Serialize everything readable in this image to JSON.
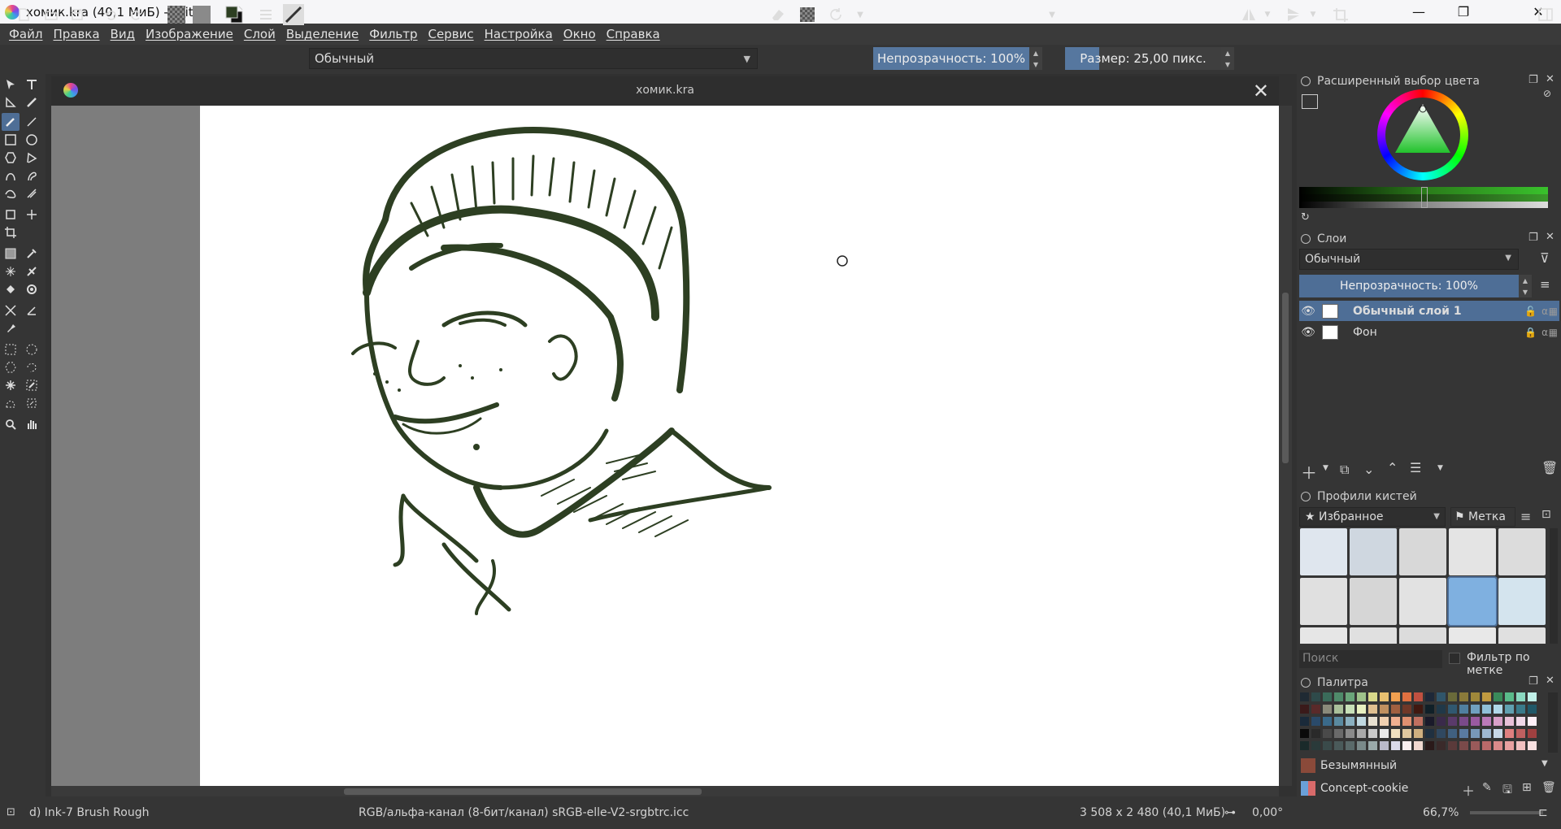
{
  "window": {
    "title": "хомик.kra (40,1 МиБ)  - Krita",
    "minimize": "—",
    "restore": "❐",
    "close": "✕"
  },
  "menu": [
    "Файл",
    "Правка",
    "Вид",
    "Изображение",
    "Слой",
    "Выделение",
    "Фильтр",
    "Сервис",
    "Настройка",
    "Окно",
    "Справка"
  ],
  "toolbar": {
    "preset_name": "Обычный",
    "opacity_label": "Непрозрачность: 100%",
    "opacity_value": 1.0,
    "size_label": "Размер: 25,00 пикс.",
    "size_value": 25.0
  },
  "document": {
    "tab_title": "хомик.kra",
    "close": "✕"
  },
  "dockers": {
    "color_selector": {
      "title": "Расширенный выбор цвета",
      "current_color": "#2d3f22"
    },
    "layers": {
      "title": "Слои",
      "blend_mode": "Обычный",
      "opacity_label": "Непрозрачность:  100%",
      "items": [
        {
          "name": "Обычный слой 1",
          "selected": true
        },
        {
          "name": "Фон",
          "selected": false
        }
      ]
    },
    "brush_presets": {
      "title": "Профили кистей",
      "tag": "Избранное",
      "tag_button": "Метка",
      "search_placeholder": "Поиск",
      "filter_by_tag": "Фильтр по метке"
    },
    "palette": {
      "title": "Палитра",
      "color_name": "Безымянный",
      "palette_name": "Concept-cookie"
    }
  },
  "status": {
    "brush": "d) Ink-7 Brush Rough",
    "color_space": "RGB/альфа-канал (8-бит/канал)  sRGB-elle-V2-srgbtrc.icc",
    "image_size": "3 508 x 2 480 (40,1 МиБ)",
    "rotation": "0,00°",
    "zoom": "66,7%"
  },
  "colors": {
    "accent": "#4e6e96",
    "ink": "#2d3f22"
  }
}
